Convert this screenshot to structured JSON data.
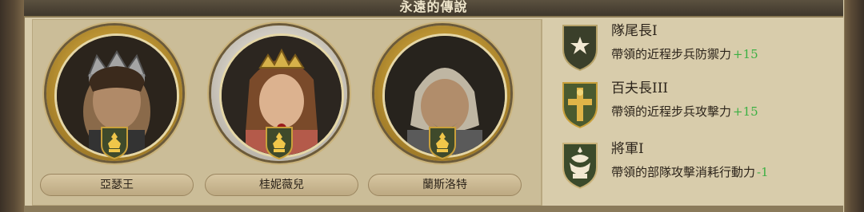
{
  "title": "永遠的傳說",
  "heroes": [
    {
      "name": "亞瑟王",
      "portrait": "king-portrait",
      "badge": "rank-badge-icon"
    },
    {
      "name": "桂妮薇兒",
      "portrait": "queen-portrait",
      "badge": "rank-badge-icon"
    },
    {
      "name": "蘭斯洛特",
      "portrait": "knight-portrait",
      "badge": "rank-badge-icon"
    }
  ],
  "ranks": [
    {
      "title": "隊尾長I",
      "desc": "帶領的近程步兵防禦力",
      "bonus": "+15",
      "icon": "star-shield-icon"
    },
    {
      "title": "百夫長III",
      "desc": "帶領的近程步兵攻擊力",
      "bonus": "+15",
      "icon": "cross-shield-icon"
    },
    {
      "title": "將軍I",
      "desc": "帶領的部隊攻擊消耗行動力",
      "bonus": "-1",
      "icon": "general-shield-icon"
    }
  ],
  "colors": {
    "bonus_text": "#3cb043",
    "panel_bg": "#d8ccab",
    "title_bar": "#3f372b",
    "badge_green": "#3f4a2b",
    "gold": "#c9a03a"
  }
}
